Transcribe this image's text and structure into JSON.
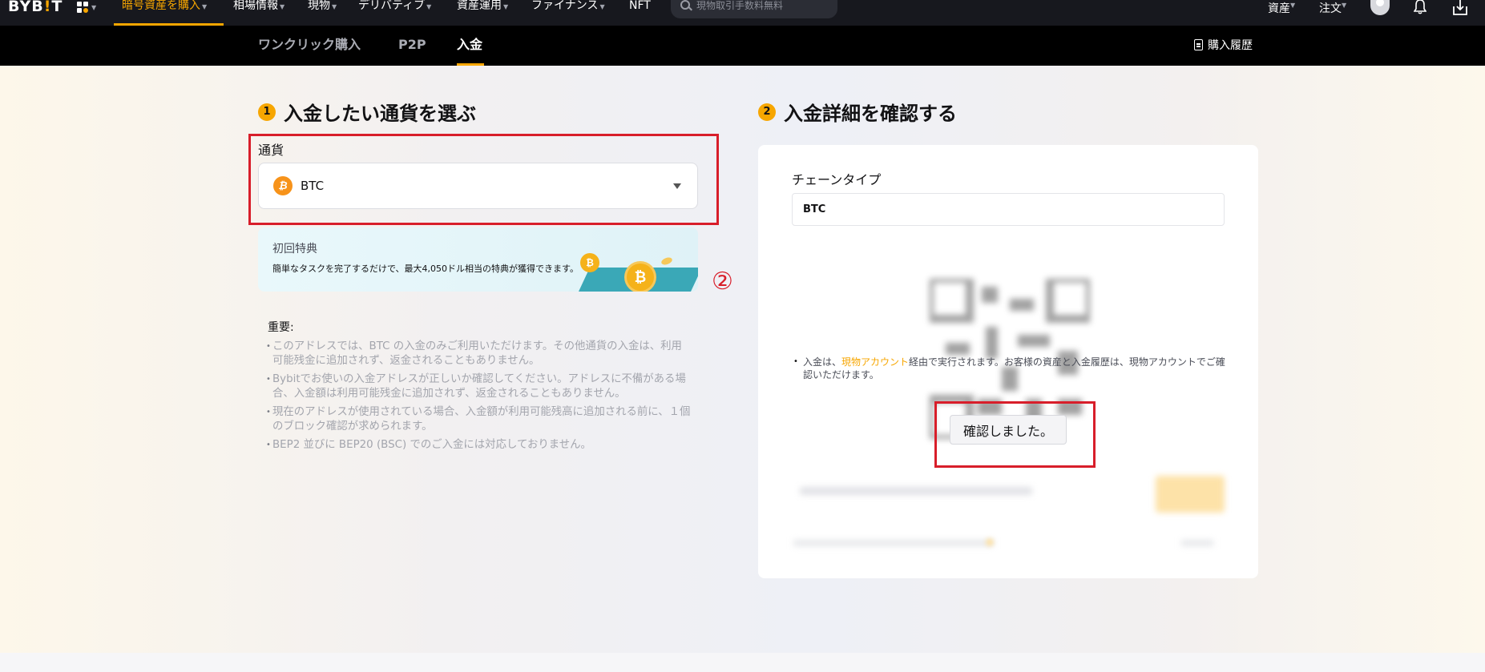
{
  "nav": {
    "logo": "BYBIT",
    "items": [
      {
        "label": "暗号資産を購入",
        "active": true
      },
      {
        "label": "相場情報"
      },
      {
        "label": "現物"
      },
      {
        "label": "デリバティブ"
      },
      {
        "label": "資産運用"
      },
      {
        "label": "ファイナンス"
      },
      {
        "label": "NFT"
      }
    ],
    "search_placeholder": "現物取引手数料無料",
    "assets": "資産",
    "orders": "注文"
  },
  "subnav": {
    "tabs": [
      {
        "label": "ワンクリック購入"
      },
      {
        "label": "P2P"
      },
      {
        "label": "入金",
        "active": true
      }
    ],
    "history": "購入履歴"
  },
  "step1": {
    "num": "1",
    "title": "入金したい通貨を選ぶ",
    "currency_label": "通貨",
    "currency_value": "BTC",
    "promo_title": "初回特典",
    "promo_desc": "簡単なタスクを完了するだけで、最大4,050ドル相当の特典が獲得できます。",
    "important_label": "重要:",
    "notes": [
      "このアドレスでは、BTC の入金のみご利用いただけます。その他通貨の入金は、利用可能残金に追加されず、返金されることもありません。",
      "Bybitでお使いの入金アドレスが正しいか確認してください。アドレスに不備がある場合、入金額は利用可能残金に追加されず、返金されることもありません。",
      "現在のアドレスが使用されている場合、入金額が利用可能残高に追加される前に、１個のブロック確認が求められます。",
      "BEP2 並びに BEP20 (BSC) でのご入金には対応しておりません。"
    ]
  },
  "step2": {
    "num": "2",
    "title": "入金詳細を確認する",
    "chain_label": "チェーンタイプ",
    "chain_value": "BTC",
    "note_prefix": "入金は、",
    "note_link": "現物アカウント",
    "note_suffix": "経由で実行されます。お客様の資産と入金履歴は、現物アカウントでご確認いただけます。",
    "confirm_button": "確認しました。"
  },
  "annotation": {
    "marker": "②",
    "color": "#d81e2a"
  },
  "colors": {
    "accent": "#f7a600",
    "nav_bg": "#17181e"
  }
}
